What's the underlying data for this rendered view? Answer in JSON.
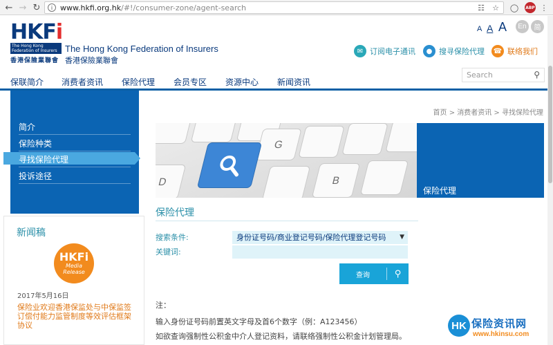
{
  "browser": {
    "url_host": "www.hkfi.org.hk",
    "url_path": "/#!/consumer-zone/agent-search",
    "abp_label": "ABP"
  },
  "header": {
    "logo_text": "HKF",
    "logo_i": "i",
    "logo_sub_1": "The Hong Kong",
    "logo_sub_2": "Federation of Insurers",
    "logo_cn": "香港保險業聯會",
    "org_en": "The Hong Kong Federation of Insurers",
    "org_cn": "香港保險業聯會",
    "font_sizes": [
      "A",
      "A",
      "A"
    ],
    "lang_en": "En",
    "lang_cn": "简",
    "tools": [
      "订阅电子通讯",
      "搜寻保险代理",
      "联络我们"
    ],
    "search_placeholder": "Search"
  },
  "nav": {
    "items": [
      "保联简介",
      "消费者资讯",
      "保险代理",
      "会员专区",
      "资源中心",
      "新闻资讯"
    ]
  },
  "sidebar": {
    "items": [
      "简介",
      "保险种类",
      "寻找保险代理",
      "投诉途径"
    ],
    "active_index": 2
  },
  "news": {
    "title": "新闻稿",
    "badge_top": "HKFi",
    "badge_mid": "Media",
    "badge_bot": "Release",
    "date": "2017年5月16日",
    "text": "保险业欢迎香港保监处与中保监签订偿付能力监管制度等效评估框架协议"
  },
  "breadcrumb": "首页 > 消费者资讯 > 寻找保险代理",
  "banner": {
    "label": "保险代理",
    "keys": [
      "G",
      "D",
      "B"
    ]
  },
  "content": {
    "title": "保险代理",
    "criteria_label": "搜索条件:",
    "criteria_value": "身份证号码/商业登记号码/保险代理登记号码",
    "keyword_label": "关键词:",
    "query_label": "查询",
    "note_title": "注：",
    "note_1": "输入身份证号码前置英文字母及首6个数字（例：A123456）",
    "note_2": "如欲查询强制性公积金中介人登记资料，请联络强制性公积金计划管理局。"
  },
  "watermark": {
    "hk": "HK",
    "cn": "保险资讯网",
    "url": "www.hkinsu.com"
  }
}
